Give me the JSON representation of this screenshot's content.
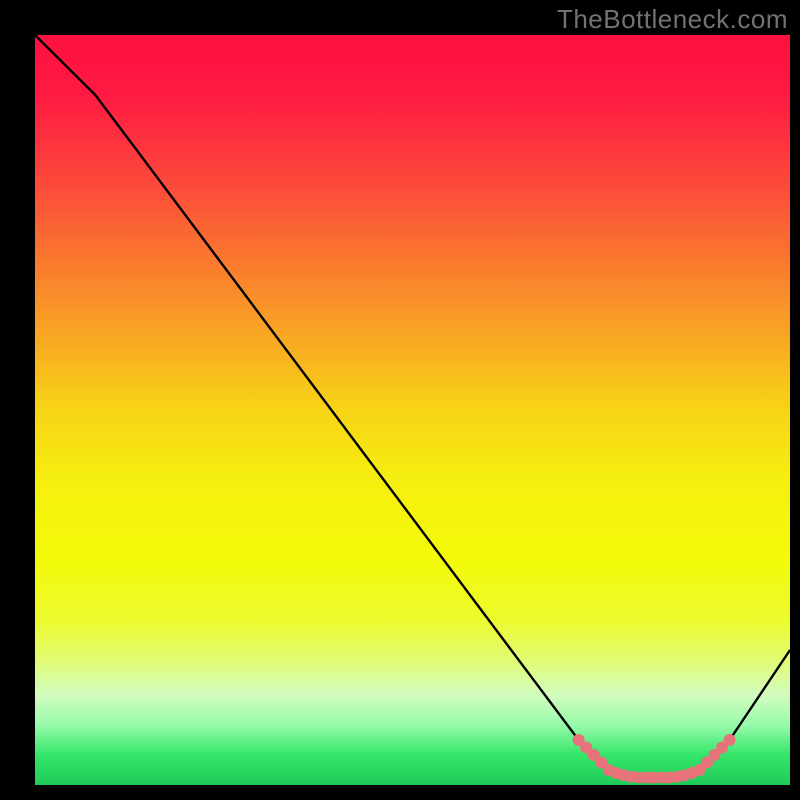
{
  "attribution": "TheBottleneck.com",
  "chart_data": {
    "type": "line",
    "title": "",
    "xlabel": "",
    "ylabel": "",
    "xrange": [
      0,
      100
    ],
    "yrange": [
      0,
      100
    ],
    "series": [
      {
        "name": "bottleneck-curve",
        "x": [
          0,
          8,
          72,
          76,
          80,
          84,
          88,
          92,
          100
        ],
        "y": [
          100,
          92,
          6,
          2,
          1,
          1,
          2,
          6,
          18
        ]
      }
    ],
    "markers": {
      "name": "highlight-dots",
      "x": [
        72,
        73,
        74,
        75,
        76,
        77,
        78,
        79,
        80,
        81,
        82,
        83,
        84,
        85,
        86,
        87,
        88,
        89,
        90,
        91,
        92
      ],
      "y": [
        6,
        5,
        4,
        3,
        2,
        1.6,
        1.3,
        1.1,
        1,
        1,
        1,
        1,
        1,
        1.1,
        1.3,
        1.6,
        2,
        3,
        4,
        5,
        6
      ]
    },
    "gradient_stops": [
      {
        "pct": 0.0,
        "color": "#fe1040"
      },
      {
        "pct": 0.08,
        "color": "#fe1a42"
      },
      {
        "pct": 0.2,
        "color": "#fc4a3a"
      },
      {
        "pct": 0.35,
        "color": "#f98f29"
      },
      {
        "pct": 0.5,
        "color": "#f7d416"
      },
      {
        "pct": 0.6,
        "color": "#f6f00f"
      },
      {
        "pct": 0.7,
        "color": "#f3fa0a"
      },
      {
        "pct": 0.78,
        "color": "#ecfb2e"
      },
      {
        "pct": 0.83,
        "color": "#e3fb6e"
      },
      {
        "pct": 0.88,
        "color": "#d2fcbf"
      },
      {
        "pct": 0.92,
        "color": "#97faaa"
      },
      {
        "pct": 0.96,
        "color": "#34e66a"
      },
      {
        "pct": 1.0,
        "color": "#1fcb58"
      }
    ],
    "plot_left": 35,
    "plot_right": 790,
    "plot_top": 35,
    "plot_bottom": 785,
    "curve_color": "#000000",
    "marker_color": "#e8727a",
    "marker_radius": 6
  }
}
